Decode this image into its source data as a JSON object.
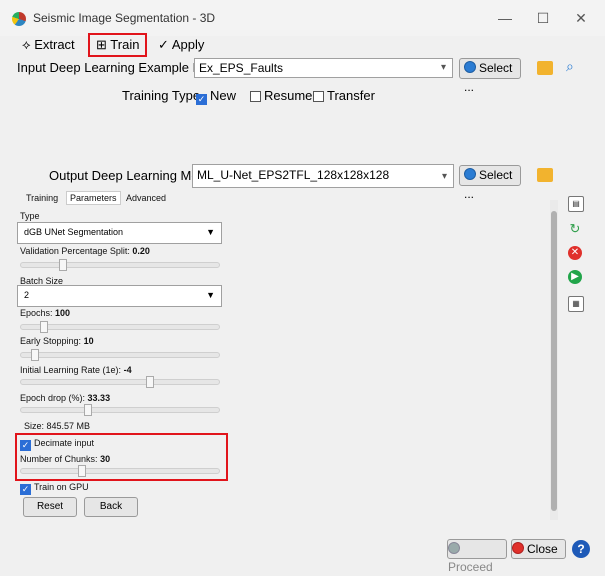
{
  "window": {
    "title": "Seismic Image Segmentation - 3D",
    "minimize": "—",
    "maximize": "☐",
    "close": "✕"
  },
  "tabs": [
    {
      "label": "Extract",
      "icon": "extract-icon"
    },
    {
      "label": "Train",
      "icon": "train-icon"
    },
    {
      "label": "Apply",
      "icon": "apply-icon"
    }
  ],
  "input": {
    "label": "Input Deep Learning Example Data",
    "value": "Ex_EPS_Faults",
    "select_label": "Select ..."
  },
  "training_type": {
    "label": "Training Type",
    "options": [
      "New",
      "Resume",
      "Transfer"
    ],
    "checked": "New"
  },
  "output": {
    "label": "Output Deep Learning Model",
    "value": "ML_U-Net_EPS2TFL_128x128x128",
    "select_label": "Select ..."
  },
  "subtabs": [
    "Training",
    "Parameters",
    "Advanced"
  ],
  "params": {
    "type_label": "Type",
    "type_value": "dGB UNet Segmentation",
    "validation_label": "Validation Percentage Split:",
    "validation_value": "0.20",
    "validation_level": 0.2,
    "batch_label": "Batch Size",
    "batch_value": "2",
    "epochs_label": "Epochs:",
    "epochs_value": "100",
    "epochs_level": 0.1,
    "early_label": "Early Stopping:",
    "early_value": "10",
    "early_level": 0.05,
    "lr_label": "Initial Learning Rate (1e):",
    "lr_value": "-4",
    "lr_level": 0.66,
    "drop_label": "Epoch drop (%):",
    "drop_value": "33.33",
    "drop_level": 0.33,
    "size_text": "Size: 845.57 MB",
    "decimate_label": "Decimate input",
    "chunks_label": "Number of Chunks:",
    "chunks_value": "30",
    "chunks_level": 0.3,
    "gpu_label": "Train on GPU",
    "reset_label": "Reset",
    "back_label": "Back"
  },
  "footer": {
    "proceed": "Proceed",
    "close": "Close",
    "help": "?"
  },
  "colors": {
    "accent_red": "#e1141b",
    "select_blue": "#2b7cd3"
  }
}
